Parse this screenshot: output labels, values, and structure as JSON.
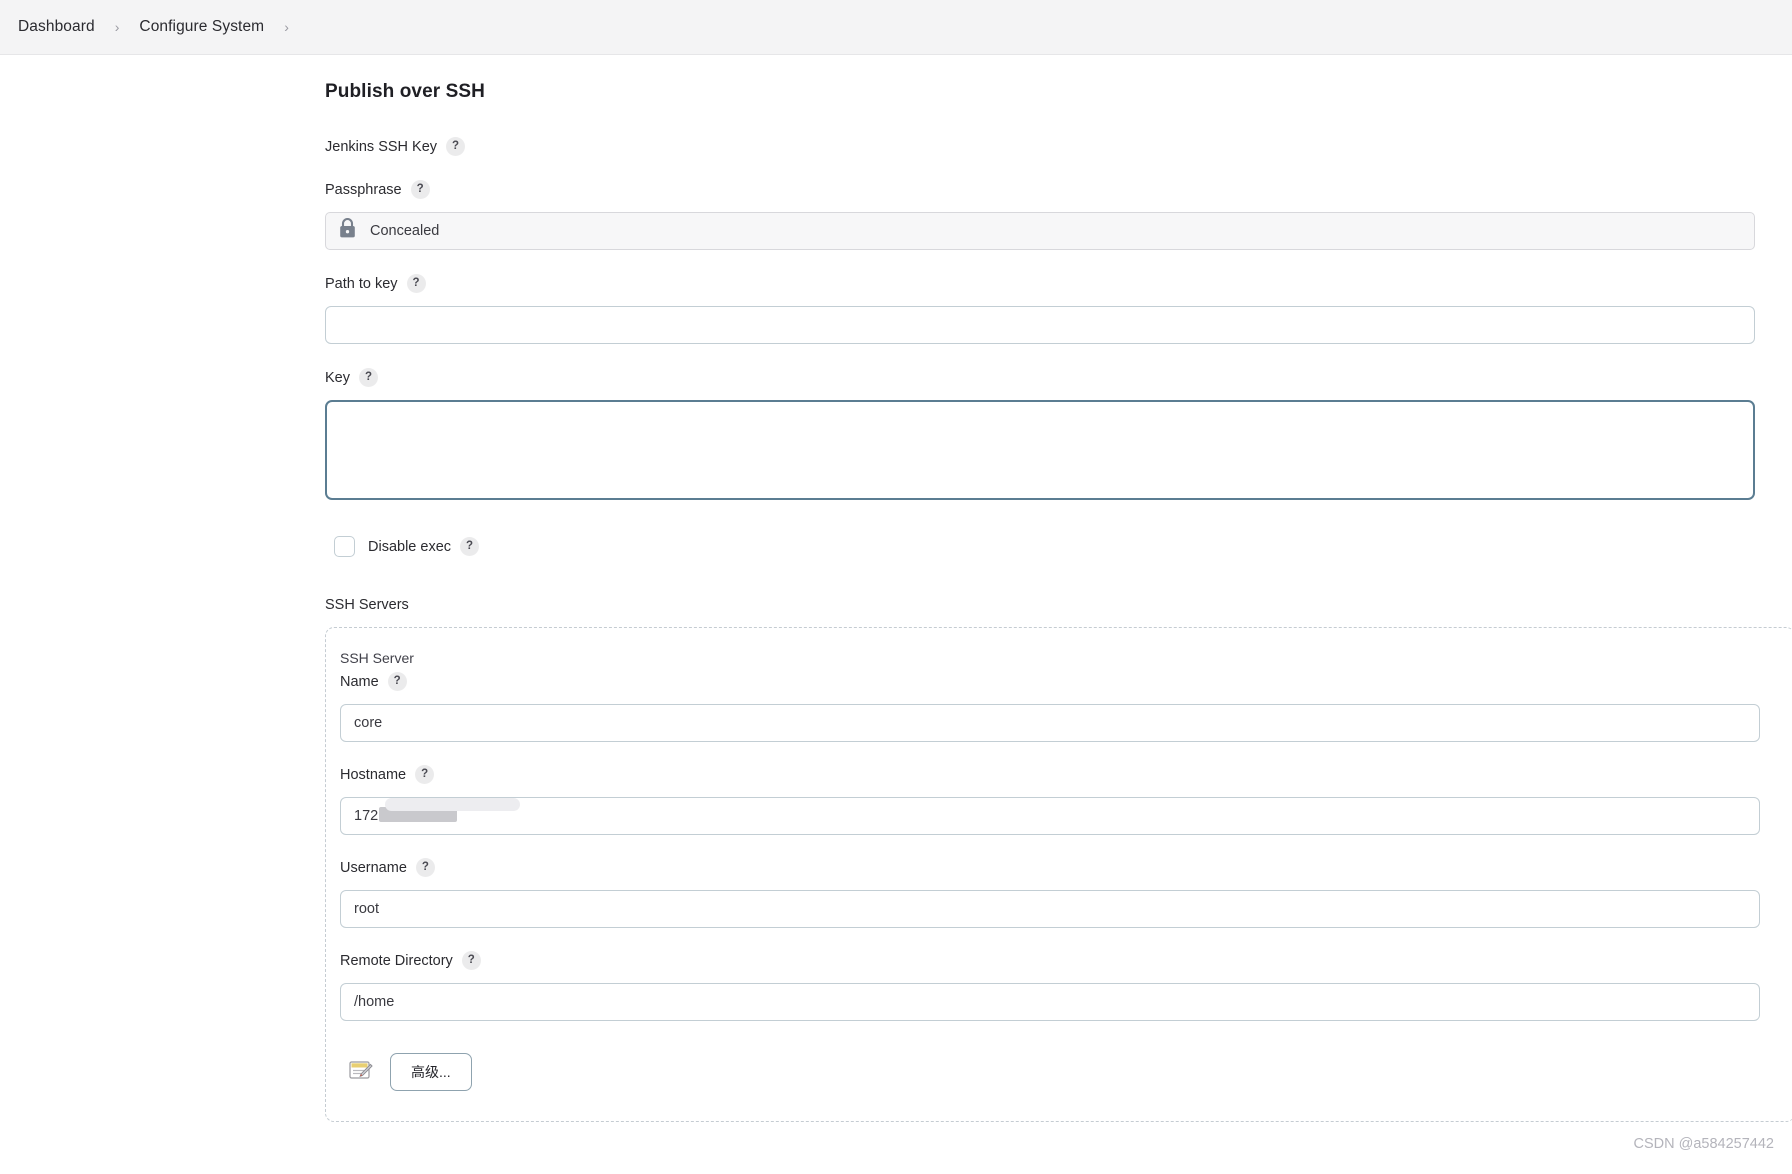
{
  "breadcrumb": {
    "items": [
      {
        "label": "Dashboard"
      },
      {
        "label": "Configure System"
      }
    ],
    "separator": "›"
  },
  "page": {
    "title": "Publish over SSH"
  },
  "form": {
    "jenkins_ssh_key": {
      "label": "Jenkins SSH Key",
      "help": "?"
    },
    "passphrase": {
      "label": "Passphrase",
      "help": "?",
      "value": "Concealed",
      "icon": "lock-icon"
    },
    "path_to_key": {
      "label": "Path to key",
      "help": "?",
      "value": "",
      "placeholder": ""
    },
    "key": {
      "label": "Key",
      "help": "?",
      "value": "",
      "focused": true
    },
    "disable_exec": {
      "label": "Disable exec",
      "help": "?",
      "checked": false
    }
  },
  "ssh_servers": {
    "section_label": "SSH Servers",
    "server": {
      "caption": "SSH Server",
      "name": {
        "label": "Name",
        "help": "?",
        "value": "core"
      },
      "hostname": {
        "label": "Hostname",
        "help": "?",
        "value": "172.1",
        "redacted": true
      },
      "username": {
        "label": "Username",
        "help": "?",
        "value": "root"
      },
      "remote_directory": {
        "label": "Remote Directory",
        "help": "?",
        "value": "/home"
      },
      "advanced_button": {
        "label": "高级...",
        "icon": "notepad-pencil-icon"
      }
    }
  },
  "watermark": {
    "text": "CSDN @a584257442"
  },
  "colors": {
    "breadcrumb_bg": "#f4f4f5",
    "input_border": "#c3ced4",
    "focus_border": "#5b7d92",
    "help_badge_bg": "#ebebec",
    "dashed_border": "#c5ccd2",
    "text": "#2b2b30"
  }
}
